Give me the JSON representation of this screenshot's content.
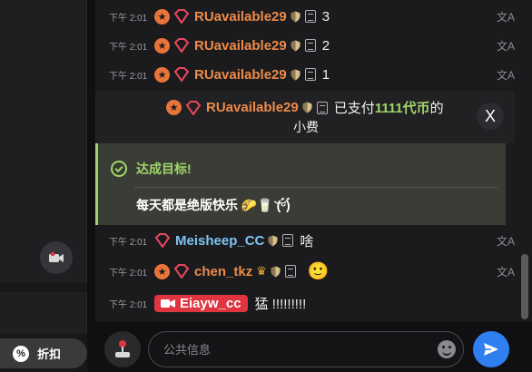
{
  "sidebar": {
    "discount_label": "折扣",
    "discount_icon": "%"
  },
  "chat": {
    "messages_top": [
      {
        "time": "下午 2:01",
        "username": "RUavailable29",
        "text": "3",
        "translate": "文A"
      },
      {
        "time": "下午 2:01",
        "username": "RUavailable29",
        "text": "2",
        "translate": "文A"
      },
      {
        "time": "下午 2:01",
        "username": "RUavailable29",
        "text": "1",
        "translate": "文A"
      }
    ],
    "tip": {
      "username": "RUavailable29",
      "prefix": "已支付",
      "amount": "1111代币",
      "suffix": "的",
      "line2": "小费",
      "close_glyph": "X"
    },
    "goal": {
      "title": "达成目标!",
      "text": "每天都是绝版快乐 🌮🥛 (ؑ᷅ᵕؑ᷄)"
    },
    "messages_bottom": [
      {
        "time": "下午 2:01",
        "username": "Meisheep_CC",
        "text": "啥",
        "translate": "文A"
      },
      {
        "time": "下午 2:01",
        "username": "chen_tkz",
        "text": "🙂",
        "translate": "文A"
      },
      {
        "time": "下午 2:01",
        "username": "Eiayw_cc",
        "text": "猛 !!!!!!!!!"
      }
    ]
  },
  "input": {
    "placeholder": "公共信息"
  },
  "colors": {
    "accent_orange": "#ec8b4a",
    "accent_green": "#9fd66a",
    "send_blue": "#2f7ff0",
    "cam_red": "#e0353f"
  }
}
